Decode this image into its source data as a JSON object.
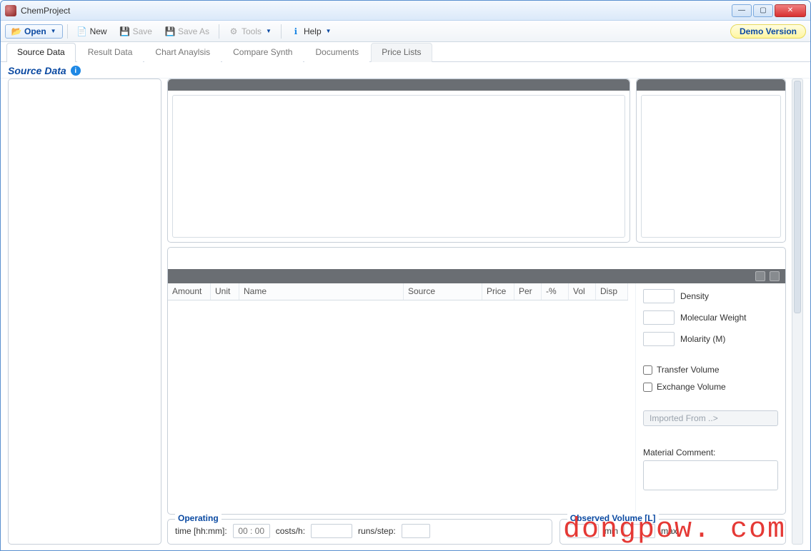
{
  "window": {
    "title": "ChemProject"
  },
  "toolbar": {
    "open": "Open",
    "new": "New",
    "save": "Save",
    "save_as": "Save As",
    "tools": "Tools",
    "help": "Help",
    "demo_badge": "Demo Version"
  },
  "tabs": [
    {
      "label": "Source Data",
      "active": true
    },
    {
      "label": "Result Data"
    },
    {
      "label": "Chart Anaylsis"
    },
    {
      "label": "Compare Synth"
    },
    {
      "label": "Documents"
    },
    {
      "label": "Price Lists",
      "dim": true
    }
  ],
  "section": {
    "title": "Source Data"
  },
  "table": {
    "columns": {
      "amount": "Amount",
      "unit": "Unit",
      "name": "Name",
      "source": "Source",
      "price": "Price",
      "per": "Per",
      "pct": "-%",
      "vol": "Vol",
      "disp": "Disp"
    }
  },
  "props": {
    "density": "Density",
    "molweight": "Molecular Weight",
    "molarity": "Molarity (M)",
    "transfer_volume": "Transfer Volume",
    "exchange_volume": "Exchange Volume",
    "imported_from": "Imported From ..>",
    "material_comment_label": "Material Comment:"
  },
  "operating": {
    "legend": "Operating",
    "time_label": "time [hh:mm]:",
    "time_placeholder": "00 : 00",
    "costs_label": "costs/h:",
    "runs_label": "runs/step:"
  },
  "observed": {
    "legend": "Observed Volume [L]",
    "min_label": "min",
    "max_label": "max"
  },
  "watermark": "dongpow. com"
}
